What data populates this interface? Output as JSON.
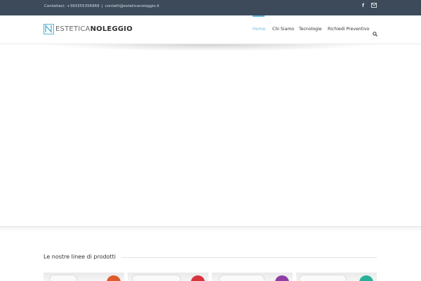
{
  "topbar": {
    "contact_label": "Contattaci: +393355356969",
    "separator": "|",
    "email": "contatti@esteticanoleggio.it",
    "social": [
      {
        "icon": "facebook-icon"
      },
      {
        "icon": "mail-icon"
      }
    ]
  },
  "logo": {
    "part1": "ESTETICA",
    "part2": "NOLEGGIO",
    "accent": "#5ab3d8"
  },
  "nav": {
    "items": [
      {
        "label": "Home",
        "active": true
      },
      {
        "label": "Chi Siamo",
        "active": false
      },
      {
        "label": "Tecnologie",
        "active": false
      },
      {
        "label": "Richiedi Preventivo",
        "active": false
      }
    ],
    "search_icon": "search-icon"
  },
  "section": {
    "title": "Le nostre linee di prodotti"
  },
  "products": [
    {
      "badge_color": "#e05a2b"
    },
    {
      "badge_color": "#d8343e"
    },
    {
      "badge_color": "#8e3fa3"
    },
    {
      "badge_color": "#27b199"
    }
  ],
  "colors": {
    "topbar": "#3c4a5a",
    "accent": "#65bde0"
  }
}
